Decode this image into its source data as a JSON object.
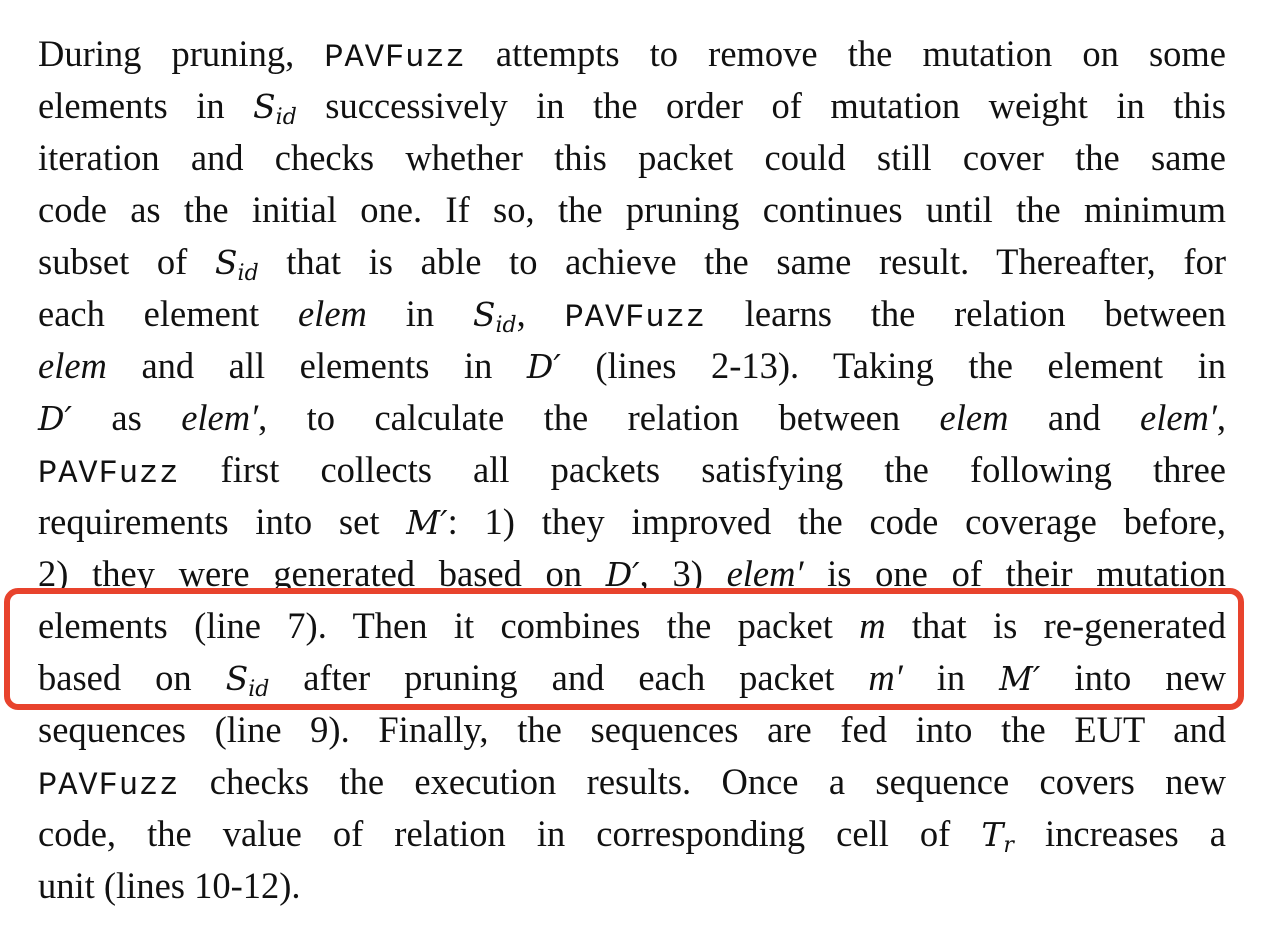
{
  "paragraph": {
    "lines": [
      [
        {
          "t": "text",
          "v": "During pruning, "
        },
        {
          "t": "mono",
          "v": "PAVFuzz"
        },
        {
          "t": "text",
          "v": " attempts to remove the mutation on some"
        }
      ],
      [
        {
          "t": "text",
          "v": "elements in "
        },
        {
          "t": "cal",
          "v": "S",
          "sub": "id"
        },
        {
          "t": "text",
          "v": " successively in the order of mutation weight in this"
        }
      ],
      [
        {
          "t": "text",
          "v": "iteration and checks whether this packet could still cover the same"
        }
      ],
      [
        {
          "t": "text",
          "v": "code as the initial one. If so, the pruning continues until the minimum"
        }
      ],
      [
        {
          "t": "text",
          "v": "subset of "
        },
        {
          "t": "cal",
          "v": "S",
          "sub": "id"
        },
        {
          "t": "text",
          "v": " that is able to achieve the same result. Thereafter, for"
        }
      ],
      [
        {
          "t": "text",
          "v": "each element "
        },
        {
          "t": "math",
          "v": "elem"
        },
        {
          "t": "text",
          "v": " in "
        },
        {
          "t": "cal",
          "v": "S",
          "sub": "id"
        },
        {
          "t": "text",
          "v": ", "
        },
        {
          "t": "mono",
          "v": "PAVFuzz"
        },
        {
          "t": "text",
          "v": " learns the relation between"
        }
      ],
      [
        {
          "t": "math",
          "v": "elem"
        },
        {
          "t": "text",
          "v": " and all elements in "
        },
        {
          "t": "cal",
          "v": "D′"
        },
        {
          "t": "text",
          "v": " (lines 2-13). Taking the element in"
        }
      ],
      [
        {
          "t": "cal",
          "v": "D′"
        },
        {
          "t": "text",
          "v": " as "
        },
        {
          "t": "math",
          "v": "elem′"
        },
        {
          "t": "text",
          "v": ", to calculate the relation between "
        },
        {
          "t": "math",
          "v": "elem"
        },
        {
          "t": "text",
          "v": " and "
        },
        {
          "t": "math",
          "v": "elem′"
        },
        {
          "t": "text",
          "v": ","
        }
      ],
      [
        {
          "t": "mono",
          "v": "PAVFuzz"
        },
        {
          "t": "text",
          "v": " first collects all packets satisfying the following three"
        }
      ],
      [
        {
          "t": "text",
          "v": "requirements into set "
        },
        {
          "t": "cal",
          "v": "M′"
        },
        {
          "t": "text",
          "v": ": 1) they improved the code coverage before,"
        }
      ],
      [
        {
          "t": "text",
          "v": "2) they were generated based on "
        },
        {
          "t": "cal",
          "v": "D′"
        },
        {
          "t": "text",
          "v": ", 3) "
        },
        {
          "t": "math",
          "v": "elem′"
        },
        {
          "t": "text",
          "v": " is one of their mutation"
        }
      ],
      [
        {
          "t": "text",
          "v": "elements (line 7). Then it combines the packet "
        },
        {
          "t": "math",
          "v": "m"
        },
        {
          "t": "text",
          "v": " that is re-generated"
        }
      ],
      [
        {
          "t": "text",
          "v": "based on "
        },
        {
          "t": "cal",
          "v": "S",
          "sub": "id"
        },
        {
          "t": "text",
          "v": " after pruning and each packet "
        },
        {
          "t": "math",
          "v": "m′"
        },
        {
          "t": "text",
          "v": " in "
        },
        {
          "t": "cal",
          "v": "M′"
        },
        {
          "t": "text",
          "v": " into new"
        }
      ],
      [
        {
          "t": "text",
          "v": "sequences (line 9). Finally, the sequences are fed into the EUT and"
        }
      ],
      [
        {
          "t": "mono",
          "v": "PAVFuzz"
        },
        {
          "t": "text",
          "v": " checks the execution results. Once a sequence covers new"
        }
      ],
      [
        {
          "t": "text",
          "v": "code, the value of relation in corresponding cell of "
        },
        {
          "t": "cal",
          "v": "T",
          "sub": "r"
        },
        {
          "t": "text",
          "v": " increases a"
        }
      ],
      [
        {
          "t": "text",
          "v": "unit (lines 10-12)."
        }
      ]
    ]
  },
  "highlight": {
    "color": "#e8432d"
  }
}
